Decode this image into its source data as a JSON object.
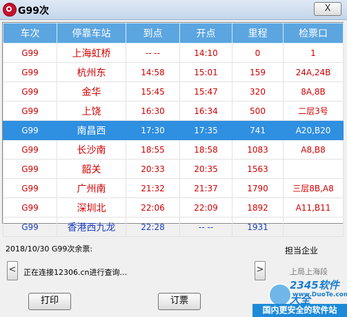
{
  "window": {
    "title": "G99次",
    "close_label": "X"
  },
  "table": {
    "headers": [
      "车次",
      "停靠车站",
      "到点",
      "开点",
      "里程",
      "检票口"
    ],
    "rows": [
      {
        "train": "G99",
        "station": "上海虹桥",
        "arrive": "-- --",
        "depart": "14:10",
        "km": "0",
        "gate": "1"
      },
      {
        "train": "G99",
        "station": "杭州东",
        "arrive": "14:58",
        "depart": "15:01",
        "km": "159",
        "gate": "24A,24B"
      },
      {
        "train": "G99",
        "station": "金华",
        "arrive": "15:45",
        "depart": "15:47",
        "km": "320",
        "gate": "8A,8B"
      },
      {
        "train": "G99",
        "station": "上饶",
        "arrive": "16:30",
        "depart": "16:34",
        "km": "500",
        "gate": "二层3号"
      },
      {
        "train": "G99",
        "station": "南昌西",
        "arrive": "17:30",
        "depart": "17:35",
        "km": "741",
        "gate": "A20,B20"
      },
      {
        "train": "G99",
        "station": "长沙南",
        "arrive": "18:55",
        "depart": "18:58",
        "km": "1083",
        "gate": "A8,B8"
      },
      {
        "train": "G99",
        "station": "韶关",
        "arrive": "20:33",
        "depart": "20:35",
        "km": "1563",
        "gate": ""
      },
      {
        "train": "G99",
        "station": "广州南",
        "arrive": "21:32",
        "depart": "21:37",
        "km": "1790",
        "gate": "三层8B,A8"
      },
      {
        "train": "G99",
        "station": "深圳北",
        "arrive": "22:06",
        "depart": "22:09",
        "km": "1892",
        "gate": "A11,B11"
      },
      {
        "train": "G99",
        "station": "香港西九龙",
        "arrive": "22:28",
        "depart": "-- --",
        "km": "1931",
        "gate": ""
      }
    ]
  },
  "footer": {
    "ticket_label": "2018/10/30 G99次余票:",
    "status_text": "正在连接12306.cn进行查询...",
    "company_label": "担当企业",
    "company_value": "上局上海段",
    "print_label": "打印",
    "order_label": "订票",
    "scroll_left": "<",
    "scroll_right": ">"
  },
  "watermark": {
    "brand": "2345软件大全",
    "url": "www.DuoTe.com",
    "banner": "国内更安全的软件站"
  },
  "colors": {
    "header_bg": "#5ba5e0",
    "selected_row": "#2f8fe0",
    "row_text": "#d00000",
    "last_row_text": "#1f3fc0"
  }
}
